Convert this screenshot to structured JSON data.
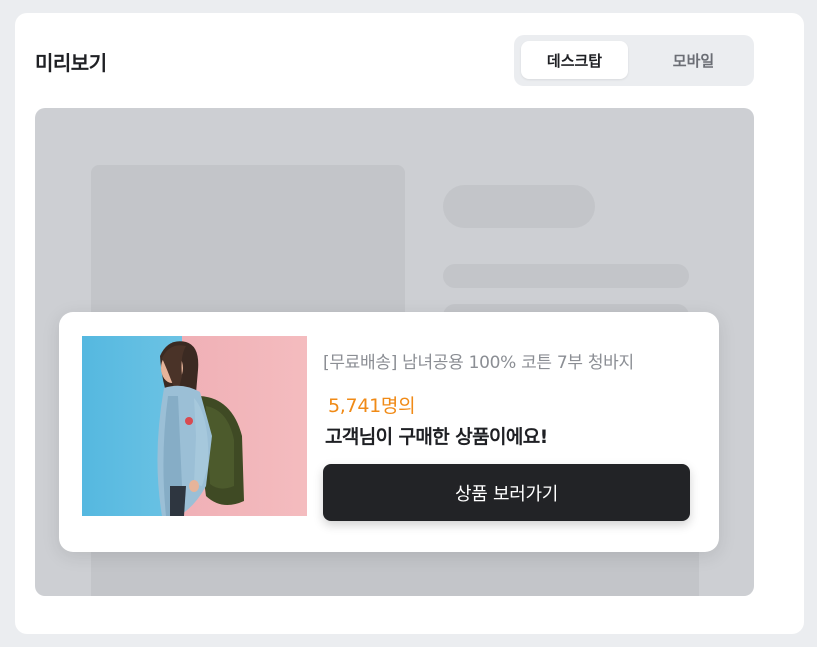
{
  "header": {
    "title": "미리보기"
  },
  "view_toggle": {
    "options": [
      "데스크탑",
      "모바일"
    ],
    "selected": "데스크탑"
  },
  "popup": {
    "product_name": "[무료배송] 남녀공용 100% 코튼 7부 청바지",
    "purchase_count": "5,741명의",
    "message": "고객님이 구매한 상품이에요!",
    "cta_label": "상품 보러가기",
    "image_subject": "woman-in-denim-jacket-photo"
  },
  "colors": {
    "accent": "#f08a16",
    "cta_bg": "#222326",
    "page_bg": "#ebedf0"
  }
}
